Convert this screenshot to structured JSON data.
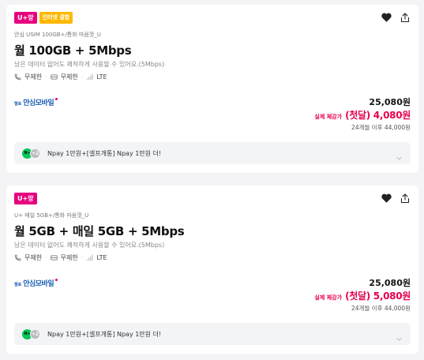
{
  "plans": [
    {
      "badges": [
        "U+망",
        "인터넷 결합"
      ],
      "subtitle": "안심 USIM 100GB+/통화 마음껏_U",
      "name": "월 100GB + 5Mbps",
      "description": "남은 데이터 없어도 쾌적하게 사용할 수 있어요.(5Mbps)",
      "specs": {
        "call": "무제한",
        "sms": "무제한",
        "network": "LTE"
      },
      "brand": {
        "small": "헬로",
        "main": "안심모바일"
      },
      "price": "25,080원",
      "discount_label": "실제 체감가",
      "discount_value": "(첫달) 4,080원",
      "after_price": "24개월 이후 44,000원",
      "promo": {
        "icon_label": "N+",
        "more_count": "+2",
        "text": "Npay 1만원+[셀프개통] Npay 1만원 더!"
      }
    },
    {
      "badges": [
        "U+망"
      ],
      "subtitle": "U+ 매일 5GB+/통화 마음껏_U",
      "name": "월 5GB + 매일 5GB + 5Mbps",
      "description": "남은 데이터 없어도 쾌적하게 사용할 수 있어요.(5Mbps)",
      "specs": {
        "call": "무제한",
        "sms": "무제한",
        "network": "LTE"
      },
      "brand": {
        "small": "헬로",
        "main": "안심모바일"
      },
      "price": "25,080원",
      "discount_label": "실제 체감가",
      "discount_value": "(첫달) 5,080원",
      "after_price": "24개월 이후 44,000원",
      "promo": {
        "icon_label": "N+",
        "more_count": "+2",
        "text": "Npay 1만원+[셀프개통] Npay 1만원 더!"
      }
    }
  ],
  "icons": {
    "favorite": "heart-icon",
    "share": "share-icon",
    "call": "phone-icon",
    "sms": "message-icon",
    "network": "signal-icon",
    "expand": "chevron-down-icon"
  },
  "colors": {
    "uplus_badge": "#e6007e",
    "internet_badge": "#ffb800",
    "discount": "#e6004c",
    "brand": "#1a5fb4",
    "npay": "#03c75a"
  }
}
